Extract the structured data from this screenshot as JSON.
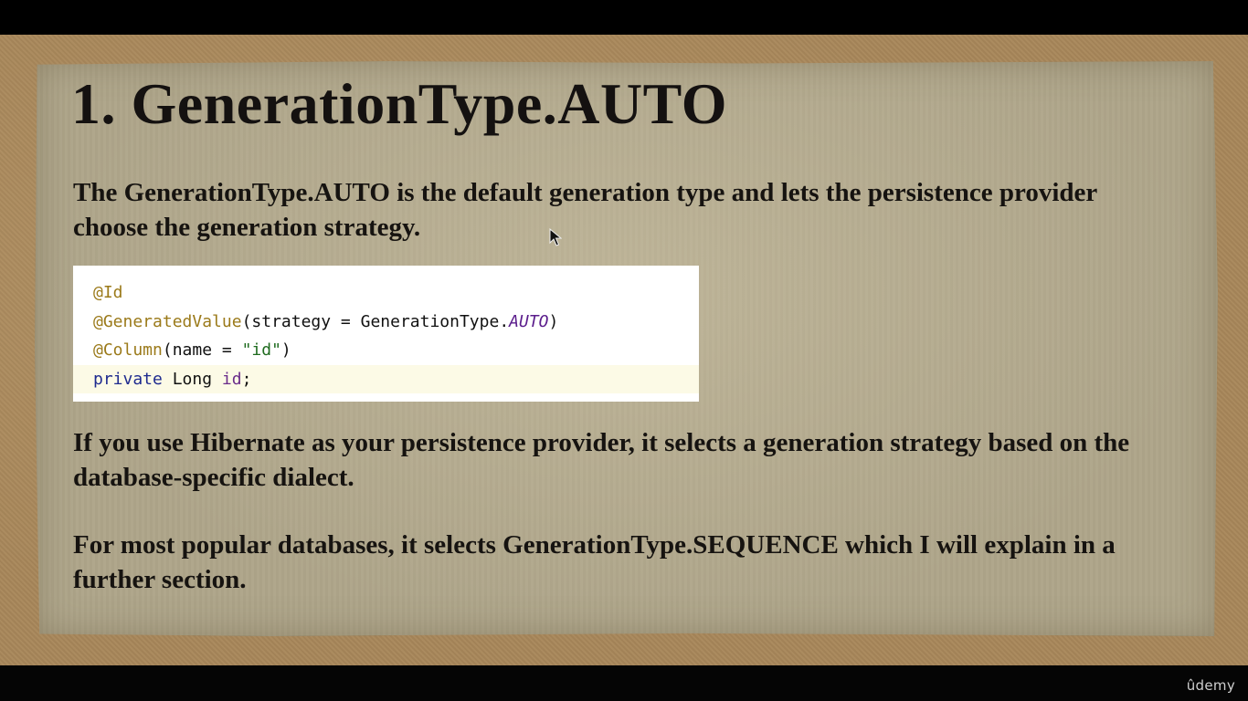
{
  "slide": {
    "title": "1. GenerationType.AUTO",
    "paragraph_1": "The GenerationType.AUTO is the default generation type and lets the persistence provider choose the generation strategy.",
    "paragraph_2": "If you use Hibernate as your persistence provider, it selects a generation strategy based on the database-specific dialect.",
    "paragraph_3": "For most popular databases, it selects GenerationType.SEQUENCE which I will explain in a further section."
  },
  "code": {
    "line_1": {
      "annotation": "@Id"
    },
    "line_2": {
      "annotation": "@GeneratedValue",
      "open": "(strategy = GenerationType.",
      "enum": "AUTO",
      "close": ")"
    },
    "line_3": {
      "annotation": "@Column",
      "open": "(name = ",
      "string": "\"id\"",
      "close": ")"
    },
    "line_4": {
      "keyword": "private",
      "type": " Long ",
      "field": "id",
      "end": ";"
    }
  },
  "player": {
    "brand": "ûdemy"
  },
  "colors": {
    "annotation": "#9b7a1a",
    "keyword": "#1f2b8f",
    "enum_constant": "#5b1d8c",
    "string": "#1f6b1f",
    "paper": "#aea58a",
    "cork": "#a8875a"
  }
}
